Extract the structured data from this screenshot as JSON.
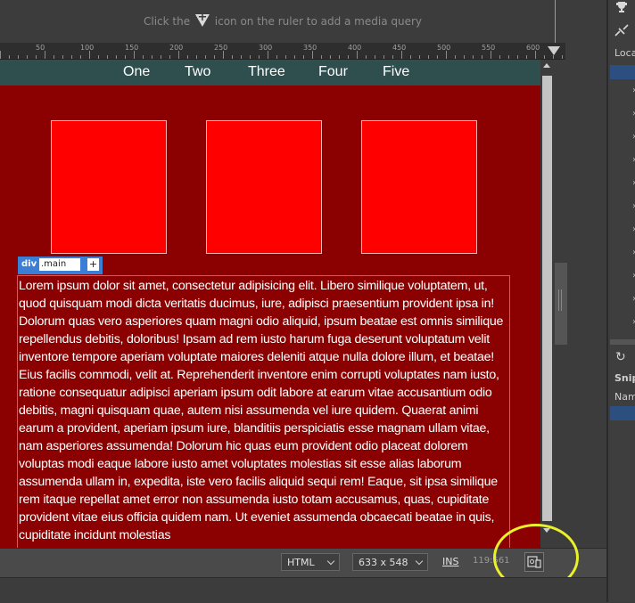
{
  "media_query_bar": {
    "hint_before": "Click the",
    "hint_after": "icon on the ruler to add a media query"
  },
  "ruler": {
    "labels": [
      "50",
      "100",
      "150",
      "200",
      "250",
      "300",
      "350",
      "400",
      "450",
      "500",
      "550",
      "600"
    ]
  },
  "nav": {
    "items": [
      "One",
      "Two",
      "Three",
      "Four",
      "Five"
    ]
  },
  "selection": {
    "tag": "div",
    "class_name": ".main",
    "add_label": "+"
  },
  "content": {
    "paragraph": "Lorem ipsum dolor sit amet, consectetur adipisicing elit. Libero similique voluptatem, ut, quod quisquam modi dicta veritatis ducimus, iure, adipisci praesentium provident ipsa in! Dolorum quas vero asperiores quam magni odio aliquid, ipsum beatae est omnis similique repellendus debitis, doloribus! Ipsam ad rem iusto harum fuga deserunt voluptatum velit inventore tempore aperiam voluptate maiores deleniti atque nulla dolore illum, et beatae! Eius facilis commodi, velit at. Reprehenderit inventore enim corrupti voluptates nam iusto, ratione consequatur adipisci aperiam ipsum odit labore at earum vitae accusantium odio debitis, magni quisquam quae, autem nisi assumenda vel iure quidem. Quaerat animi earum a provident, aperiam ipsum iure, blanditiis perspiciatis esse magnam ullam vitae, nam asperiores assumenda! Dolorum hic quas eum provident odio placeat dolorem voluptas modi eaque labore iusto amet voluptates molestias sit esse alias laborum assumenda ullam in, expedita, iste vero facilis aliquid sequi rem! Eaque, sit ipsa similique rem itaque repellat amet error non assumenda iusto totam accusamus, quas, cupiditate provident vitae eius officia quidem nam. Ut eveniet assumenda obcaecati beatae in quis, cupiditate incidunt molestias"
  },
  "status_bar": {
    "language": "HTML",
    "size": "633 x 548",
    "mode": "INS",
    "position": "119:561"
  },
  "right_panel": {
    "label_locations": "Loca",
    "label_snippets": "Snipp",
    "label_name": "Nam"
  },
  "colors": {
    "page_background": "#8b0000",
    "nav_background": "#2f4f4f",
    "box_fill": "#ff0000",
    "selection_blue": "#3a7fd5",
    "highlight_circle": "#eaf02a"
  }
}
